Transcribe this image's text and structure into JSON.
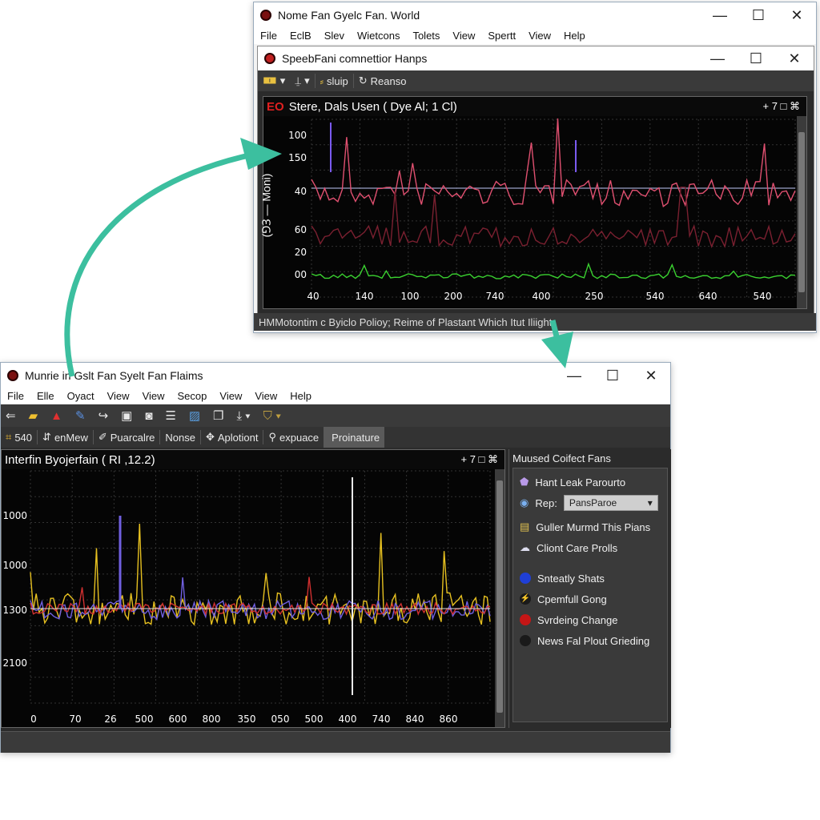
{
  "top_window": {
    "title": "Nome Fan Gyelc Fan. World",
    "menu": [
      "File",
      "EclB",
      "Slev",
      "Wietcons",
      "Tolets",
      "View",
      "Spertt",
      "View",
      "Help"
    ],
    "inner_title": "SpeebFani comnettior Hanps",
    "toolbar": [
      "sluip",
      "Reanso"
    ],
    "plot_title_prefix": "EO",
    "plot_title": "Stere, Dals Usen ( Dye Al; 1 Cl)",
    "plot_controls": "+ 7 □ ⌘",
    "y_label": "(⅁Ɜ — Moni)",
    "y_ticks": [
      "100",
      "150",
      "40",
      "60",
      "20",
      "00"
    ],
    "x_ticks": [
      "40",
      "140",
      "100",
      "200",
      "740",
      "400",
      "250",
      "540",
      "640",
      "540"
    ],
    "status": "HMMotontim c Byiclo Polioy; Reime of Plastant Which Itut Iliight"
  },
  "bottom_window": {
    "title": "Munrie in Gslt Fan Syelt Fan Flaims",
    "menu": [
      "File",
      "Elle",
      "Oyact",
      "View",
      "View",
      "Secop",
      "View",
      "View",
      "Help"
    ],
    "tabs": [
      "540",
      "enMew",
      "Puarcalre",
      "Nonse",
      "Aplotiont",
      "expuace",
      "Proinature"
    ],
    "plot_title": "Interfin Byojerfain ( RI ,12.2)",
    "plot_controls": "+ 7 □ ⌘",
    "y_ticks": [
      "1000",
      "1000",
      "1300",
      "2100"
    ],
    "x_ticks": [
      "0",
      "70",
      "26",
      "500",
      "600",
      "800",
      "350",
      "050",
      "500",
      "400",
      "740",
      "840",
      "860"
    ],
    "panel_title": "Muused Coifect Fans",
    "panel_items": [
      {
        "label": "Hant Leak Parourto",
        "icon": "purple-gem-icon"
      },
      {
        "label": "Rep:",
        "icon": "radio-icon",
        "select": "PansParoe"
      },
      {
        "label": "Guller Murmd This Pians",
        "icon": "folder-icon"
      },
      {
        "label": "Cliont Care Prolls",
        "icon": "cloud-icon"
      }
    ],
    "legend": [
      {
        "label": "Snteatly Shats",
        "color": "#1f3fd6"
      },
      {
        "label": "Cpemfull Gong",
        "color": "#1fae3a"
      },
      {
        "label": "Svrdeing Change",
        "color": "#c41616"
      },
      {
        "label": "News Fal Plout Grieding",
        "color": "#1a1a1a"
      }
    ]
  },
  "colors": {
    "accent_arrow": "#3cbf9f",
    "plot_bg": "#050505",
    "panel_bg": "#2b2b2b"
  }
}
